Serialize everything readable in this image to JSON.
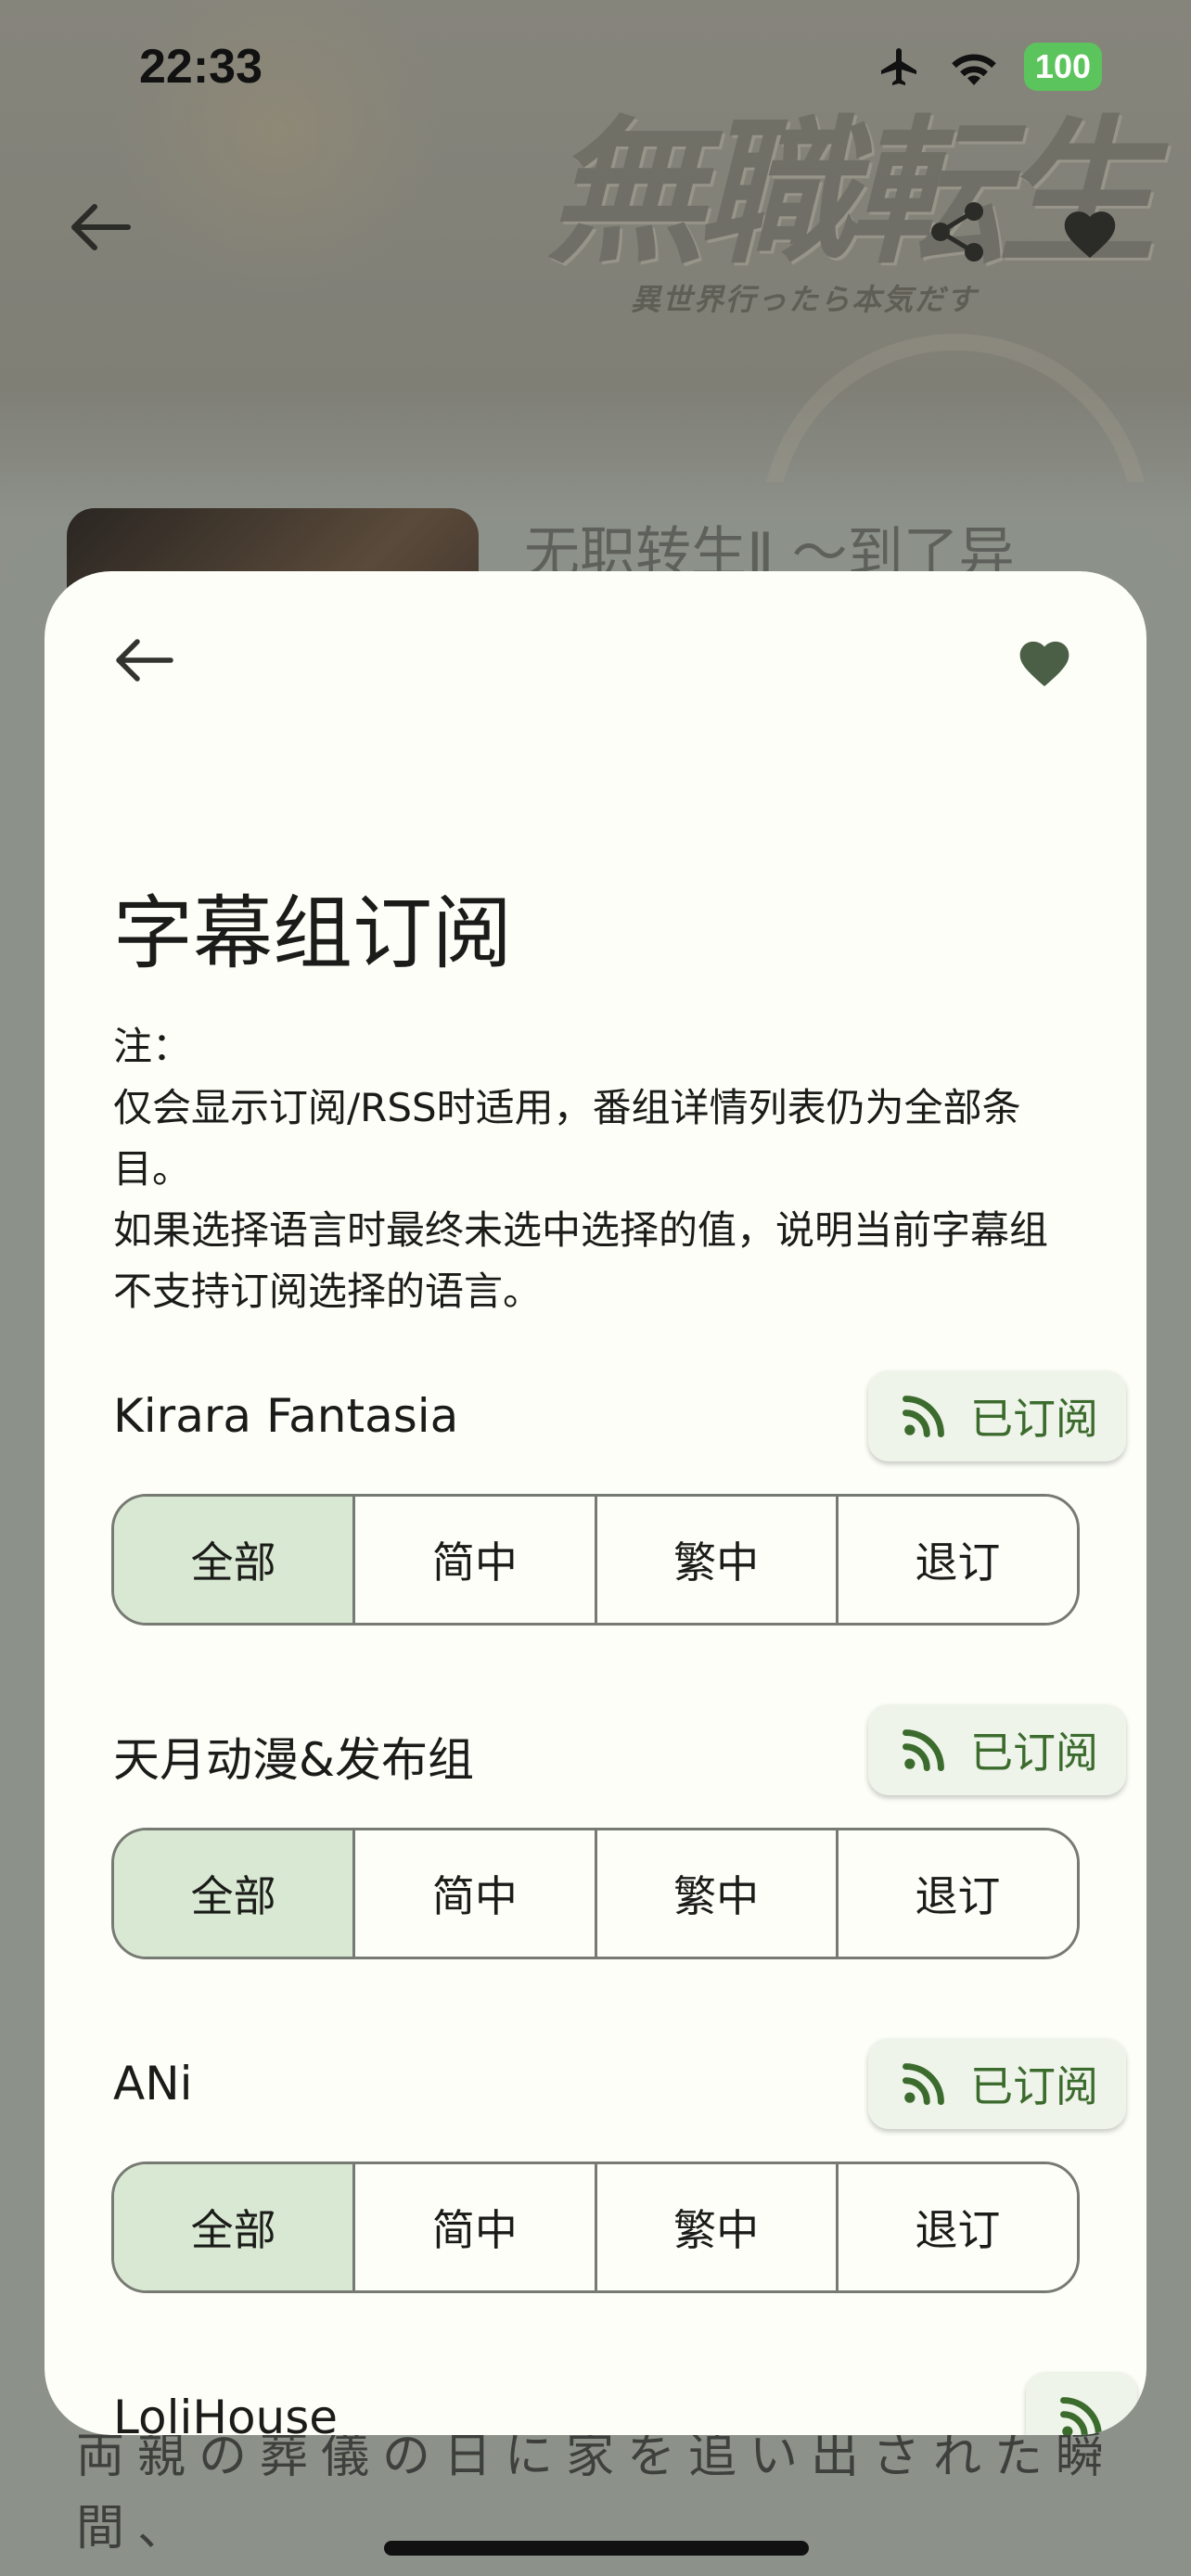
{
  "status_bar": {
    "time": "22:33",
    "battery": "100"
  },
  "background": {
    "logo_text": "無職転生",
    "logo_subtitle": "異世界行ったら本気だす",
    "title_partial": "无职转生Ⅱ ～到了异",
    "bottom_text": "両親の葬儀の日に家を追い出された瞬間、"
  },
  "sheet": {
    "title": "字幕组订阅",
    "note_lines": [
      "注：",
      "仅会显示订阅/RSS时适用，番组详情列表仍为全部条目。",
      "如果选择语言时最终未选中选择的值，说明当前字幕组不支持订阅选择的语言。"
    ],
    "groups": [
      {
        "name": "Kirara Fantasia",
        "subscribe_label": "已订阅",
        "options": [
          "全部",
          "简中",
          "繁中",
          "退订"
        ],
        "selected": "全部"
      },
      {
        "name": "天月动漫&发布组",
        "subscribe_label": "已订阅",
        "options": [
          "全部",
          "简中",
          "繁中",
          "退订"
        ],
        "selected": "全部"
      },
      {
        "name": "ANi",
        "subscribe_label": "已订阅",
        "options": [
          "全部",
          "简中",
          "繁中",
          "退订"
        ],
        "selected": "全部"
      },
      {
        "name": "LoliHouse"
      }
    ]
  },
  "colors": {
    "accent": "#3c6b2e",
    "selected_segment": "#d8e8d2",
    "card_bg": "#fdfef8",
    "heart": "#4a5f45"
  },
  "icons": [
    "back-arrow-icon",
    "share-icon",
    "heart-icon",
    "rss-icon",
    "airplane-icon",
    "wifi-icon"
  ]
}
